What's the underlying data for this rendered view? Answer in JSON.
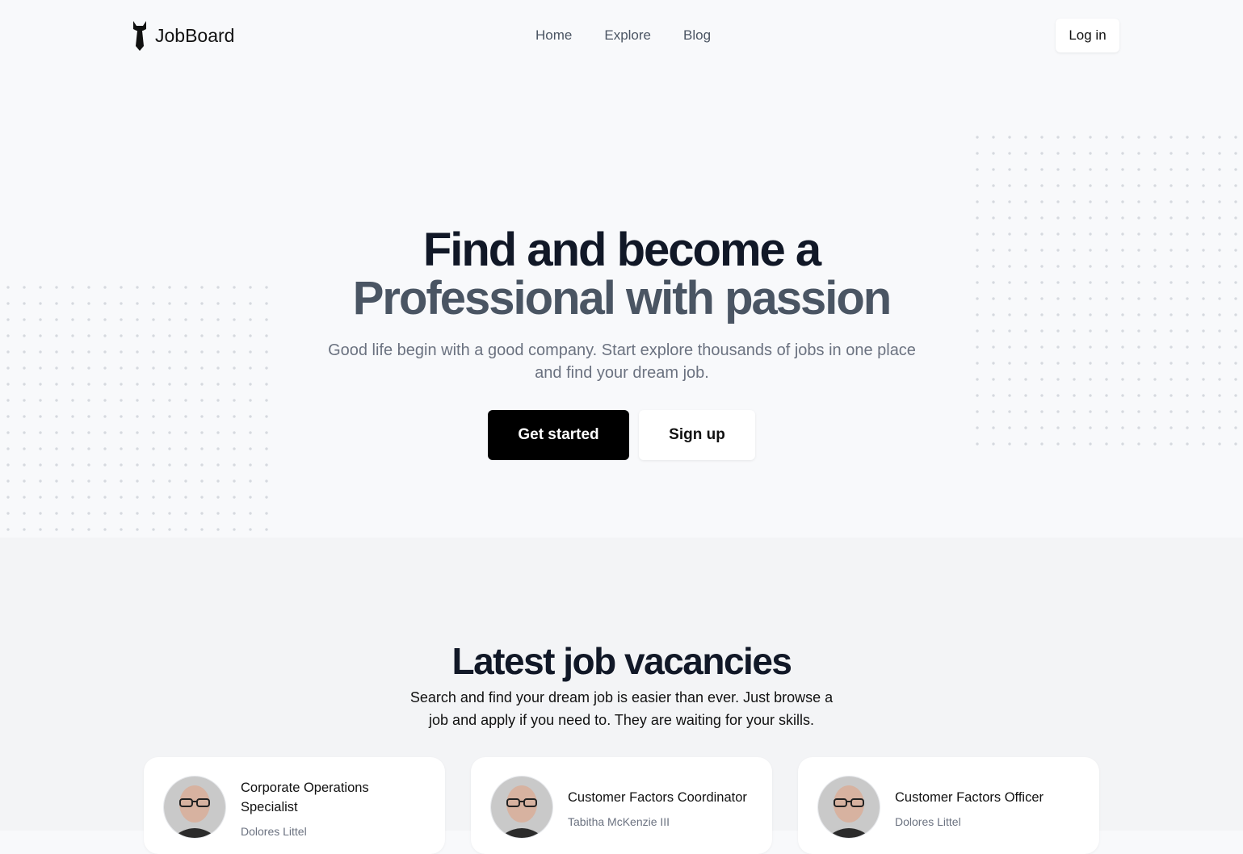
{
  "header": {
    "logo_text": "JobBoard",
    "nav": [
      "Home",
      "Explore",
      "Blog"
    ],
    "login_label": "Log in"
  },
  "hero": {
    "title_line1": "Find and become a",
    "title_line2": "Professional with passion",
    "subtitle": "Good life begin with a good company. Start explore thousands of jobs in one place and find your dream job.",
    "primary_button": "Get started",
    "secondary_button": "Sign up"
  },
  "jobs": {
    "title": "Latest job vacancies",
    "subtitle": "Search and find your dream job is easier than ever. Just browse a job and apply if you need to. They are waiting for your skills.",
    "cards": [
      {
        "title": "Corporate Operations Specialist",
        "company": "Dolores Littel",
        "icon": "person-avatar"
      },
      {
        "title": "Customer Factors Coordinator",
        "company": "Tabitha McKenzie III",
        "icon": "person-avatar"
      },
      {
        "title": "Customer Factors Officer",
        "company": "Dolores Littel",
        "icon": "person-avatar"
      }
    ]
  },
  "colors": {
    "primary_button_bg": "#000000",
    "hero_line2": "#4a5563",
    "heading": "#111827"
  }
}
